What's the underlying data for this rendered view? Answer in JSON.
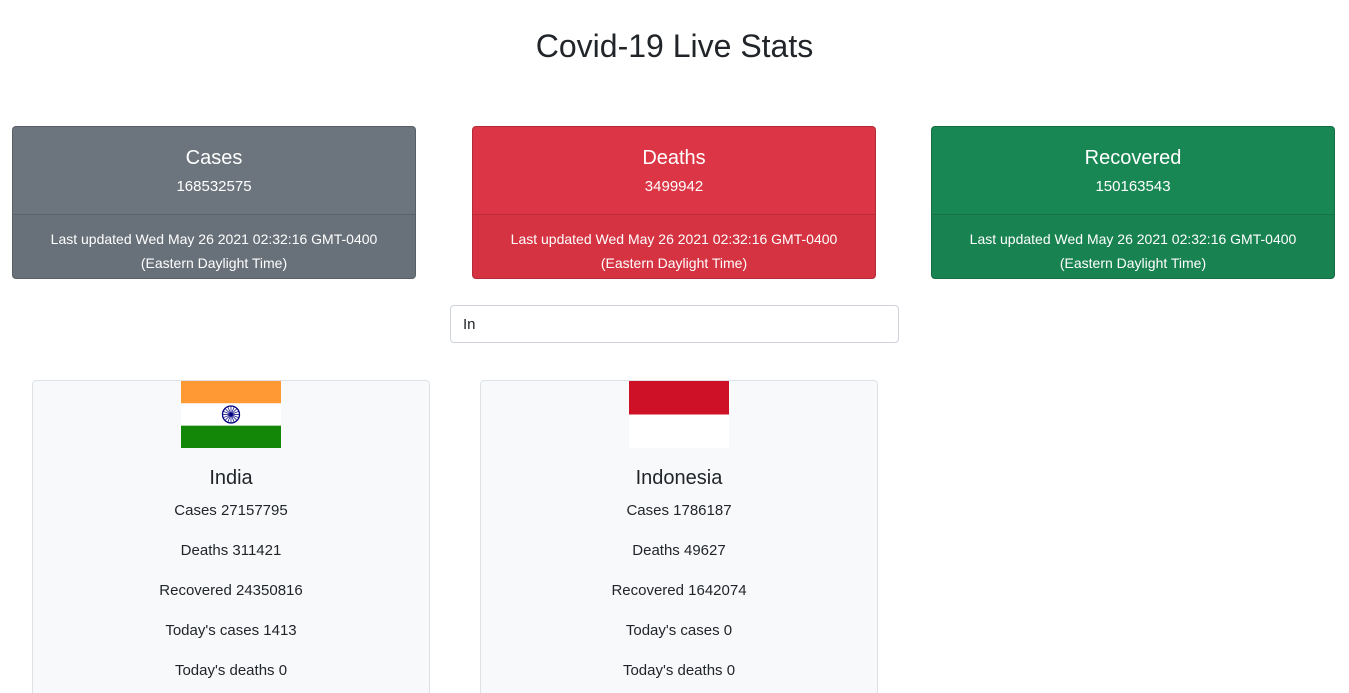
{
  "page": {
    "title": "Covid-19 Live Stats"
  },
  "colors": {
    "cases": "#6c757d",
    "deaths": "#dc3545",
    "recovered": "#198754",
    "card_bg": "#f8f9fa"
  },
  "summary": {
    "cases": {
      "label": "Cases",
      "value": "168532575",
      "updated": "Last updated Wed May 26 2021 02:32:16 GMT-0400 (Eastern Daylight Time)"
    },
    "deaths": {
      "label": "Deaths",
      "value": "3499942",
      "updated": "Last updated Wed May 26 2021 02:32:16 GMT-0400 (Eastern Daylight Time)"
    },
    "recovered": {
      "label": "Recovered",
      "value": "150163543",
      "updated": "Last updated Wed May 26 2021 02:32:16 GMT-0400 (Eastern Daylight Time)"
    }
  },
  "search": {
    "value": "In"
  },
  "labels": {
    "cases": "Cases",
    "deaths": "Deaths",
    "recovered": "Recovered",
    "today_cases": "Today's cases",
    "today_deaths": "Today's deaths"
  },
  "countries": [
    {
      "name": "India",
      "flag_icon": "india-flag-icon",
      "cases": "27157795",
      "deaths": "311421",
      "recovered": "24350816",
      "today_cases": "1413",
      "today_deaths": "0"
    },
    {
      "name": "Indonesia",
      "flag_icon": "indonesia-flag-icon",
      "cases": "1786187",
      "deaths": "49627",
      "recovered": "1642074",
      "today_cases": "0",
      "today_deaths": "0"
    }
  ]
}
